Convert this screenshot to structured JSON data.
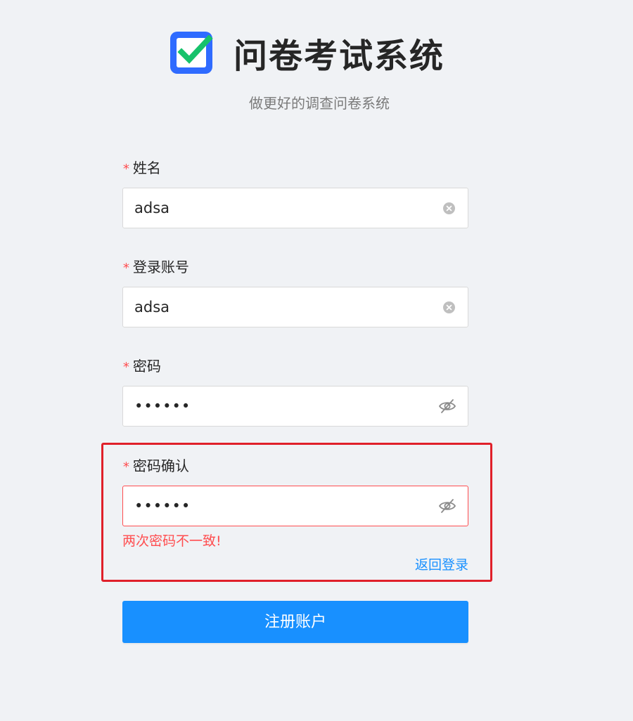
{
  "app": {
    "title": "问卷考试系统",
    "subtitle": "做更好的调查问卷系统"
  },
  "form": {
    "name": {
      "required_mark": "*",
      "label": "姓名",
      "value": "adsa"
    },
    "account": {
      "required_mark": "*",
      "label": "登录账号",
      "value": "adsa"
    },
    "password": {
      "required_mark": "*",
      "label": "密码",
      "masked_value": "••••••"
    },
    "confirm_password": {
      "required_mark": "*",
      "label": "密码确认",
      "masked_value": "••••••",
      "error": "两次密码不一致!"
    },
    "back_to_login": "返回登录",
    "submit_label": "注册账户"
  },
  "icons": {
    "logo": "checkbox-logo-icon",
    "clear": "clear-circle-icon",
    "visibility": "eye-invisible-icon"
  },
  "colors": {
    "background": "#f0f2f5",
    "primary": "#1890ff",
    "error": "#ff4d4f",
    "logo_blue": "#2f6bff",
    "logo_check": "#16c26b",
    "highlight": "#e0202a"
  }
}
